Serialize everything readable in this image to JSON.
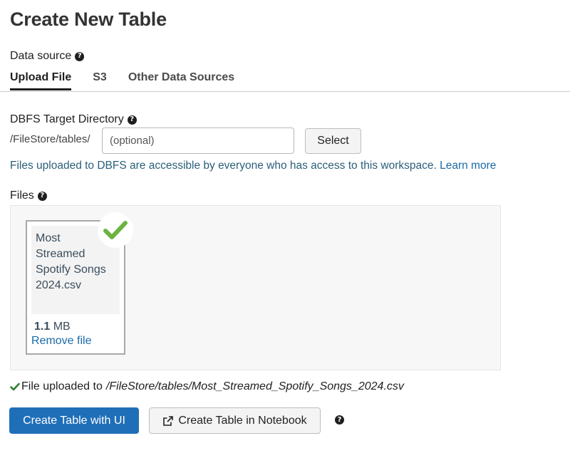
{
  "page": {
    "title": "Create New Table"
  },
  "data_source": {
    "label": "Data source",
    "tabs": [
      "Upload File",
      "S3",
      "Other Data Sources"
    ],
    "active_tab": "Upload File"
  },
  "dbfs": {
    "label": "DBFS Target Directory",
    "prefix": "/FileStore/tables/",
    "input_placeholder": "(optional)",
    "input_value": "",
    "select_label": "Select",
    "note": "Files uploaded to DBFS are accessible by everyone who has access to this workspace.",
    "learn_more": "Learn more"
  },
  "files": {
    "label": "Files",
    "items": [
      {
        "name_lines": [
          "Most",
          "Streamed",
          "Spotify Songs",
          "2024.csv"
        ],
        "size_value": "1.1",
        "size_unit": "MB",
        "remove_label": "Remove file",
        "uploaded": true
      }
    ]
  },
  "status": {
    "text": "File uploaded to",
    "path": "/FileStore/tables/Most_Streamed_Spotify_Songs_2024.csv"
  },
  "actions": {
    "create_ui": "Create Table with UI",
    "create_notebook": "Create Table in Notebook"
  },
  "icons": {
    "help": "help-circle-icon",
    "check": "check-icon",
    "external": "external-link-icon"
  },
  "colors": {
    "primary": "#1f6fb8",
    "link": "#1a6aa8",
    "success": "#6cb33f"
  }
}
